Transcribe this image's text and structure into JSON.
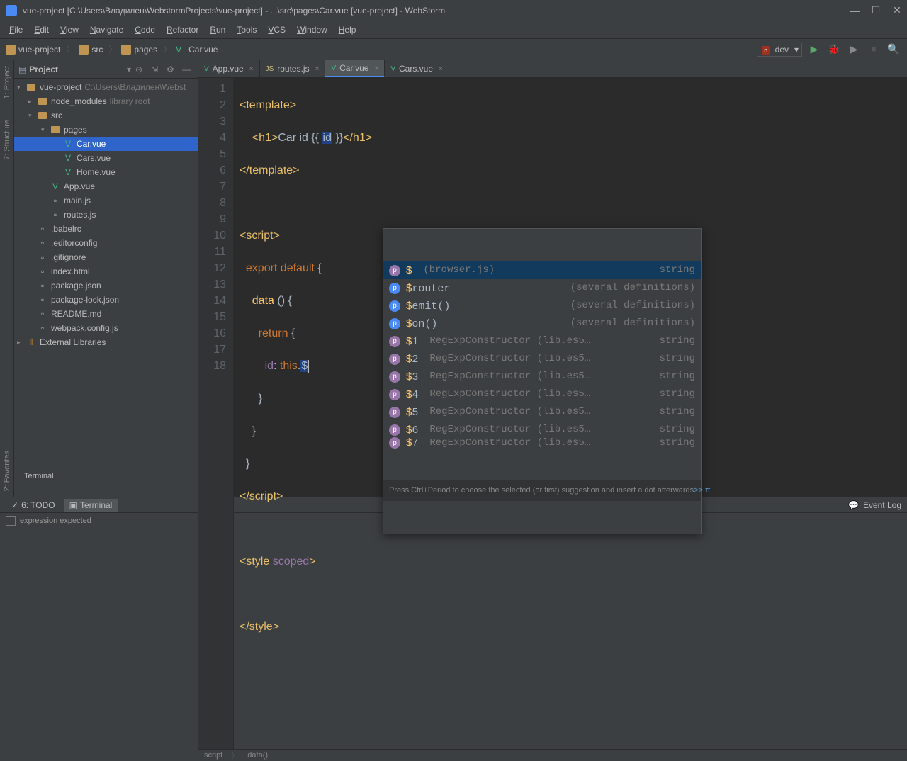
{
  "window": {
    "title": "vue-project [C:\\Users\\Владилен\\WebstormProjects\\vue-project] - ...\\src\\pages\\Car.vue [vue-project] - WebStorm"
  },
  "menu": [
    "File",
    "Edit",
    "View",
    "Navigate",
    "Code",
    "Refactor",
    "Run",
    "Tools",
    "VCS",
    "Window",
    "Help"
  ],
  "nav": {
    "crumbs": [
      {
        "icon": "folder",
        "label": "vue-project"
      },
      {
        "icon": "folder",
        "label": "src"
      },
      {
        "icon": "folder",
        "label": "pages"
      },
      {
        "icon": "vue",
        "label": "Car.vue"
      }
    ],
    "run_config": "dev"
  },
  "sidebar": {
    "title": "Project",
    "tree": [
      {
        "level": 0,
        "arrow": "▾",
        "icon": "module",
        "label": "vue-project",
        "hint": "C:\\Users\\Владилен\\Webst"
      },
      {
        "level": 1,
        "arrow": "▸",
        "icon": "folder",
        "label": "node_modules",
        "hint": "library root"
      },
      {
        "level": 1,
        "arrow": "▾",
        "icon": "folder",
        "label": "src"
      },
      {
        "level": 2,
        "arrow": "▾",
        "icon": "folder",
        "label": "pages"
      },
      {
        "level": 3,
        "arrow": "",
        "icon": "vue",
        "label": "Car.vue",
        "selected": true
      },
      {
        "level": 3,
        "arrow": "",
        "icon": "vue",
        "label": "Cars.vue"
      },
      {
        "level": 3,
        "arrow": "",
        "icon": "vue",
        "label": "Home.vue"
      },
      {
        "level": 2,
        "arrow": "",
        "icon": "vue",
        "label": "App.vue"
      },
      {
        "level": 2,
        "arrow": "",
        "icon": "js",
        "label": "main.js"
      },
      {
        "level": 2,
        "arrow": "",
        "icon": "js",
        "label": "routes.js"
      },
      {
        "level": 1,
        "arrow": "",
        "icon": "file",
        "label": ".babelrc"
      },
      {
        "level": 1,
        "arrow": "",
        "icon": "file",
        "label": ".editorconfig"
      },
      {
        "level": 1,
        "arrow": "",
        "icon": "file",
        "label": ".gitignore"
      },
      {
        "level": 1,
        "arrow": "",
        "icon": "html",
        "label": "index.html"
      },
      {
        "level": 1,
        "arrow": "",
        "icon": "json",
        "label": "package.json"
      },
      {
        "level": 1,
        "arrow": "",
        "icon": "json",
        "label": "package-lock.json"
      },
      {
        "level": 1,
        "arrow": "",
        "icon": "md",
        "label": "README.md"
      },
      {
        "level": 1,
        "arrow": "",
        "icon": "js",
        "label": "webpack.config.js"
      },
      {
        "level": 0,
        "arrow": "▸",
        "icon": "lib",
        "label": "External Libraries"
      }
    ]
  },
  "tabs": [
    {
      "icon": "vue",
      "label": "App.vue",
      "active": false
    },
    {
      "icon": "js",
      "label": "routes.js",
      "active": false
    },
    {
      "icon": "vue",
      "label": "Car.vue",
      "active": true
    },
    {
      "icon": "vue",
      "label": "Cars.vue",
      "active": false
    }
  ],
  "gutter": [
    "1",
    "2",
    "3",
    "4",
    "5",
    "6",
    "7",
    "8",
    "9",
    "10",
    "11",
    "12",
    "13",
    "14",
    "15",
    "16",
    "17",
    "18"
  ],
  "breadcrumbs": [
    "script",
    "data()"
  ],
  "autocomplete": {
    "items": [
      {
        "name": "$",
        "hint": "(browser.js)",
        "type": "string",
        "selected": true,
        "iconClass": "prop-i"
      },
      {
        "name": "$router",
        "hint": "(several definitions)",
        "type": ""
      },
      {
        "name": "$emit()",
        "hint": "(several definitions)",
        "type": ""
      },
      {
        "name": "$on()",
        "hint": "(several definitions)",
        "type": ""
      },
      {
        "name": "$1",
        "hint": "RegExpConstructor (lib.es5…",
        "type": "string",
        "iconClass": "prop-i"
      },
      {
        "name": "$2",
        "hint": "RegExpConstructor (lib.es5…",
        "type": "string",
        "iconClass": "prop-i"
      },
      {
        "name": "$3",
        "hint": "RegExpConstructor (lib.es5…",
        "type": "string",
        "iconClass": "prop-i"
      },
      {
        "name": "$4",
        "hint": "RegExpConstructor (lib.es5…",
        "type": "string",
        "iconClass": "prop-i"
      },
      {
        "name": "$5",
        "hint": "RegExpConstructor (lib.es5…",
        "type": "string",
        "iconClass": "prop-i"
      },
      {
        "name": "$6",
        "hint": "RegExpConstructor (lib.es5…",
        "type": "string",
        "iconClass": "prop-i"
      },
      {
        "name": "$7",
        "hint": "RegExpConstructor (lib.es5…",
        "type": "string",
        "iconClass": "prop-i",
        "cut": true
      }
    ],
    "footer": "Press Ctrl+Period to choose the selected (or first) suggestion and insert a dot afterwards",
    "footer_link": ">> π"
  },
  "bottom": {
    "tabs": [
      {
        "label": "6: TODO",
        "icon": "✓"
      },
      {
        "label": "Terminal",
        "icon": "▣",
        "active": true
      }
    ],
    "event_log": "Event Log"
  },
  "terminal_title": "Terminal",
  "status": "expression expected",
  "rails": {
    "left": [
      "1: Project",
      "7: Structure"
    ],
    "left_bottom": "2: Favorites"
  }
}
